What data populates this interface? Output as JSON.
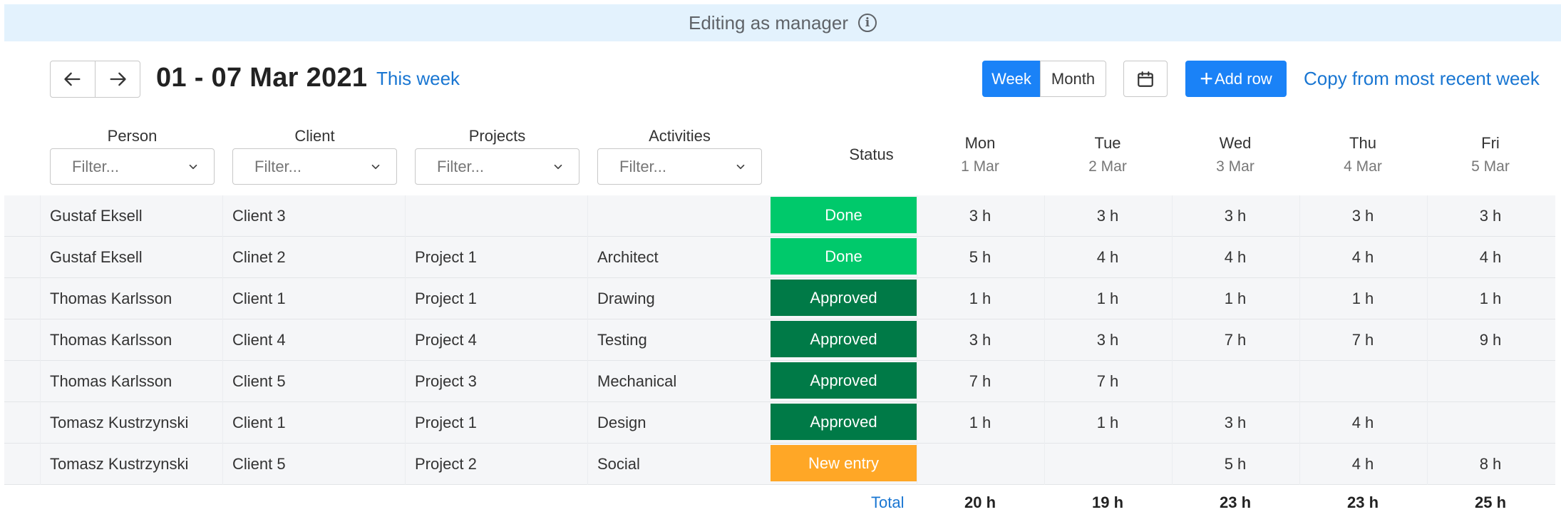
{
  "banner": {
    "text": "Editing as manager"
  },
  "header": {
    "date_range": "01 - 07 Mar 2021",
    "this_week": "This week",
    "view_week": "Week",
    "view_month": "Month",
    "add_row": "Add row",
    "copy_link": "Copy from most recent week"
  },
  "columns": {
    "person": "Person",
    "client": "Client",
    "projects": "Projects",
    "activities": "Activities",
    "status": "Status",
    "filter_placeholder": "Filter..."
  },
  "days": [
    {
      "name": "Mon",
      "date": "1 Mar"
    },
    {
      "name": "Tue",
      "date": "2 Mar"
    },
    {
      "name": "Wed",
      "date": "3 Mar"
    },
    {
      "name": "Thu",
      "date": "4 Mar"
    },
    {
      "name": "Fri",
      "date": "5 Mar"
    }
  ],
  "status_colors": {
    "Done": "#00c96b",
    "Approved": "#007a47",
    "New entry": "#ffa726"
  },
  "rows": [
    {
      "person": "Gustaf Eksell",
      "client": "Client 3",
      "project": "",
      "activity": "",
      "status": "Done",
      "hours": [
        "3 h",
        "3 h",
        "3 h",
        "3 h",
        "3 h"
      ]
    },
    {
      "person": "Gustaf Eksell",
      "client": "Clinet 2",
      "project": "Project 1",
      "activity": "Architect",
      "status": "Done",
      "hours": [
        "5 h",
        "4 h",
        "4 h",
        "4 h",
        "4 h"
      ]
    },
    {
      "person": "Thomas Karlsson",
      "client": "Client 1",
      "project": "Project 1",
      "activity": "Drawing",
      "status": "Approved",
      "hours": [
        "1 h",
        "1 h",
        "1 h",
        "1 h",
        "1 h"
      ]
    },
    {
      "person": "Thomas Karlsson",
      "client": "Client 4",
      "project": "Project 4",
      "activity": "Testing",
      "status": "Approved",
      "hours": [
        "3 h",
        "3 h",
        "7 h",
        "7 h",
        "9 h"
      ]
    },
    {
      "person": "Thomas Karlsson",
      "client": "Client 5",
      "project": "Project 3",
      "activity": "Mechanical",
      "status": "Approved",
      "hours": [
        "7 h",
        "7 h",
        "",
        "",
        ""
      ]
    },
    {
      "person": "Tomasz Kustrzynski",
      "client": "Client 1",
      "project": "Project 1",
      "activity": "Design",
      "status": "Approved",
      "hours": [
        "1 h",
        "1 h",
        "3 h",
        "4 h",
        ""
      ]
    },
    {
      "person": "Tomasz Kustrzynski",
      "client": "Client 5",
      "project": "Project 2",
      "activity": "Social",
      "status": "New entry",
      "hours": [
        "",
        "",
        "5 h",
        "4 h",
        "8 h"
      ]
    }
  ],
  "totals": {
    "label": "Total",
    "values": [
      "20 h",
      "19 h",
      "23 h",
      "23 h",
      "25 h"
    ]
  }
}
